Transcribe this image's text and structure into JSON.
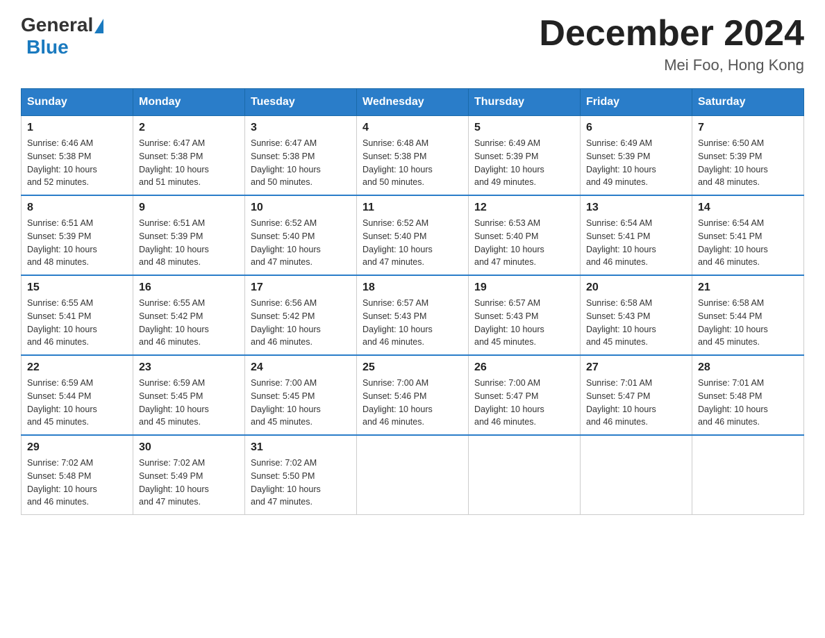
{
  "header": {
    "logo_general": "General",
    "logo_blue": "Blue",
    "month_title": "December 2024",
    "location": "Mei Foo, Hong Kong"
  },
  "weekdays": [
    "Sunday",
    "Monday",
    "Tuesday",
    "Wednesday",
    "Thursday",
    "Friday",
    "Saturday"
  ],
  "weeks": [
    [
      {
        "day": "1",
        "sunrise": "6:46 AM",
        "sunset": "5:38 PM",
        "daylight": "10 hours and 52 minutes."
      },
      {
        "day": "2",
        "sunrise": "6:47 AM",
        "sunset": "5:38 PM",
        "daylight": "10 hours and 51 minutes."
      },
      {
        "day": "3",
        "sunrise": "6:47 AM",
        "sunset": "5:38 PM",
        "daylight": "10 hours and 50 minutes."
      },
      {
        "day": "4",
        "sunrise": "6:48 AM",
        "sunset": "5:38 PM",
        "daylight": "10 hours and 50 minutes."
      },
      {
        "day": "5",
        "sunrise": "6:49 AM",
        "sunset": "5:39 PM",
        "daylight": "10 hours and 49 minutes."
      },
      {
        "day": "6",
        "sunrise": "6:49 AM",
        "sunset": "5:39 PM",
        "daylight": "10 hours and 49 minutes."
      },
      {
        "day": "7",
        "sunrise": "6:50 AM",
        "sunset": "5:39 PM",
        "daylight": "10 hours and 48 minutes."
      }
    ],
    [
      {
        "day": "8",
        "sunrise": "6:51 AM",
        "sunset": "5:39 PM",
        "daylight": "10 hours and 48 minutes."
      },
      {
        "day": "9",
        "sunrise": "6:51 AM",
        "sunset": "5:39 PM",
        "daylight": "10 hours and 48 minutes."
      },
      {
        "day": "10",
        "sunrise": "6:52 AM",
        "sunset": "5:40 PM",
        "daylight": "10 hours and 47 minutes."
      },
      {
        "day": "11",
        "sunrise": "6:52 AM",
        "sunset": "5:40 PM",
        "daylight": "10 hours and 47 minutes."
      },
      {
        "day": "12",
        "sunrise": "6:53 AM",
        "sunset": "5:40 PM",
        "daylight": "10 hours and 47 minutes."
      },
      {
        "day": "13",
        "sunrise": "6:54 AM",
        "sunset": "5:41 PM",
        "daylight": "10 hours and 46 minutes."
      },
      {
        "day": "14",
        "sunrise": "6:54 AM",
        "sunset": "5:41 PM",
        "daylight": "10 hours and 46 minutes."
      }
    ],
    [
      {
        "day": "15",
        "sunrise": "6:55 AM",
        "sunset": "5:41 PM",
        "daylight": "10 hours and 46 minutes."
      },
      {
        "day": "16",
        "sunrise": "6:55 AM",
        "sunset": "5:42 PM",
        "daylight": "10 hours and 46 minutes."
      },
      {
        "day": "17",
        "sunrise": "6:56 AM",
        "sunset": "5:42 PM",
        "daylight": "10 hours and 46 minutes."
      },
      {
        "day": "18",
        "sunrise": "6:57 AM",
        "sunset": "5:43 PM",
        "daylight": "10 hours and 46 minutes."
      },
      {
        "day": "19",
        "sunrise": "6:57 AM",
        "sunset": "5:43 PM",
        "daylight": "10 hours and 45 minutes."
      },
      {
        "day": "20",
        "sunrise": "6:58 AM",
        "sunset": "5:43 PM",
        "daylight": "10 hours and 45 minutes."
      },
      {
        "day": "21",
        "sunrise": "6:58 AM",
        "sunset": "5:44 PM",
        "daylight": "10 hours and 45 minutes."
      }
    ],
    [
      {
        "day": "22",
        "sunrise": "6:59 AM",
        "sunset": "5:44 PM",
        "daylight": "10 hours and 45 minutes."
      },
      {
        "day": "23",
        "sunrise": "6:59 AM",
        "sunset": "5:45 PM",
        "daylight": "10 hours and 45 minutes."
      },
      {
        "day": "24",
        "sunrise": "7:00 AM",
        "sunset": "5:45 PM",
        "daylight": "10 hours and 45 minutes."
      },
      {
        "day": "25",
        "sunrise": "7:00 AM",
        "sunset": "5:46 PM",
        "daylight": "10 hours and 46 minutes."
      },
      {
        "day": "26",
        "sunrise": "7:00 AM",
        "sunset": "5:47 PM",
        "daylight": "10 hours and 46 minutes."
      },
      {
        "day": "27",
        "sunrise": "7:01 AM",
        "sunset": "5:47 PM",
        "daylight": "10 hours and 46 minutes."
      },
      {
        "day": "28",
        "sunrise": "7:01 AM",
        "sunset": "5:48 PM",
        "daylight": "10 hours and 46 minutes."
      }
    ],
    [
      {
        "day": "29",
        "sunrise": "7:02 AM",
        "sunset": "5:48 PM",
        "daylight": "10 hours and 46 minutes."
      },
      {
        "day": "30",
        "sunrise": "7:02 AM",
        "sunset": "5:49 PM",
        "daylight": "10 hours and 47 minutes."
      },
      {
        "day": "31",
        "sunrise": "7:02 AM",
        "sunset": "5:50 PM",
        "daylight": "10 hours and 47 minutes."
      },
      null,
      null,
      null,
      null
    ]
  ],
  "labels": {
    "sunrise": "Sunrise:",
    "sunset": "Sunset:",
    "daylight": "Daylight:"
  }
}
